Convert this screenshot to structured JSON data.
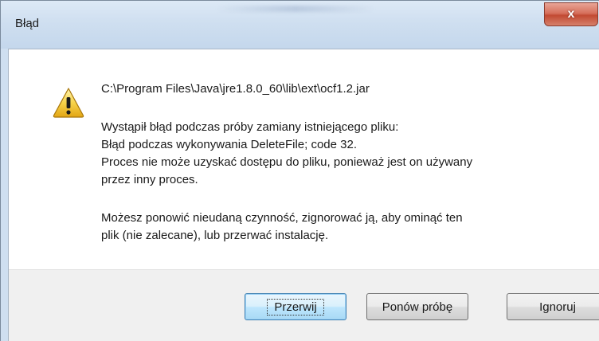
{
  "window": {
    "title": "Błąd",
    "close_glyph": "x"
  },
  "dialog": {
    "path": "C:\\Program Files\\Java\\jre1.8.0_60\\lib\\ext\\ocf1.2.jar",
    "message_lines": [
      "Wystąpił błąd podczas próby zamiany istniejącego pliku:",
      "Błąd podczas wykonywania DeleteFile; code 32.",
      "Proces nie może uzyskać dostępu do pliku, ponieważ jest on używany",
      "przez inny proces."
    ],
    "advice_lines": [
      "Możesz ponowić nieudaną czynność, zignorować ją, aby ominąć ten",
      "plik (nie zalecane), lub przerwać instalację."
    ],
    "icon": "warning-icon"
  },
  "buttons": {
    "abort_label": "Przerwij",
    "retry_label": "Ponów próbę",
    "ignore_label": "Ignoruj"
  }
}
